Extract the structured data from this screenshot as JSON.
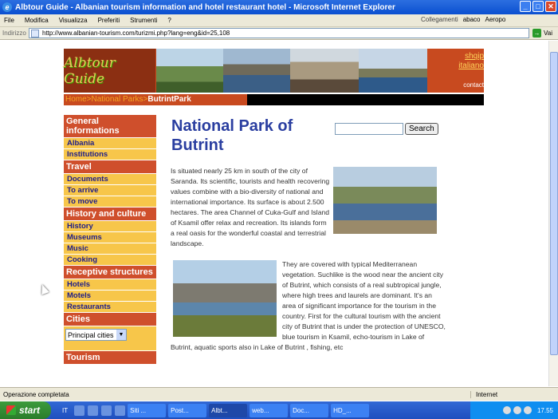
{
  "window": {
    "title": "Albtour Guide - Albanian tourism information and hotel restaurant hotel - Microsoft Internet Explorer"
  },
  "menu": [
    "File",
    "Modifica",
    "Visualizza",
    "Preferiti",
    "Strumenti",
    "?"
  ],
  "links_bar": {
    "label": "Collegamenti",
    "items": [
      "abaco",
      "Aeropo"
    ]
  },
  "address": {
    "label": "Indirizzo",
    "url": "http://www.albanian-tourism.com/turizmi.php?lang=eng&id=25,108",
    "go": "Vai"
  },
  "site": {
    "logo": "Albtour Guide",
    "langs": [
      "shqip",
      "italiano"
    ],
    "contact": "contact",
    "breadcrumb": {
      "prefix": "Home>National Parks>",
      "current": "ButrintPark"
    },
    "nav": [
      {
        "cat": "General informations",
        "items": [
          "Albania",
          "Institutions"
        ]
      },
      {
        "cat": "Travel",
        "items": [
          "Documents",
          "To arrive",
          "To move"
        ]
      },
      {
        "cat": "History and culture",
        "items": [
          "History",
          "Museums",
          "Music",
          "Cooking"
        ]
      },
      {
        "cat": "Receptive structures",
        "items": [
          "Hotels",
          "Motels",
          "Restaurants"
        ]
      },
      {
        "cat": "Cities",
        "select": "Principal cities"
      },
      {
        "cat": "Tourism",
        "items": []
      }
    ],
    "heading": "National Park of Butrint",
    "search_button": "Search",
    "para1": "Is situated nearly 25 km in south of the city of Saranda. Its scientific, tourists and health recovering values combine with a bio-diversity of national and international importance. Its surface is about 2.500 hectares. The area Channel of Cuka-Gulf and Island of Ksamil offer relax and recreation. Its islands form a real oasis for the wonderful coastal and terrestrial landscape.",
    "para2": "They are covered with typical Mediterranean vegetation. Suchlike is the wood near the ancient city of Butrint, which consists of a real subtropical jungle, where high trees and laurels are dominant. It's an area of significant importance for the tourism in the country. First for the cultural tourism with the ancient city of Butrint that is under the protection of UNESCO, blue tourism in Ksamil, echo-tourism in Lake of Butrint, aquatic sports also in Lake of Butrint , fishing, etc"
  },
  "status": {
    "text": "Operazione completata",
    "zone": "Internet"
  },
  "taskbar": {
    "start": "start",
    "lang": "IT",
    "buttons": [
      "Siti ...",
      "Post...",
      "Albt...",
      "web...",
      "Doc...",
      "HD_..."
    ],
    "clock": "17.55"
  }
}
